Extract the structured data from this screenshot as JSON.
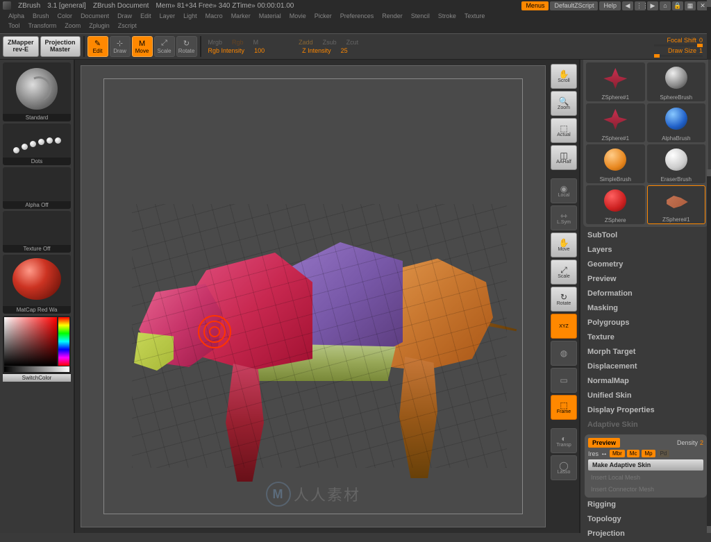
{
  "title": {
    "app": "ZBrush",
    "ver": "3.1 [general]",
    "doc": "ZBrush Document",
    "mem": "Mem» 81+34  Free» 340  ZTime» 00:00:01.00"
  },
  "titlebtns": {
    "menus": "Menus",
    "script": "DefaultZScript",
    "help": "Help"
  },
  "menu1": [
    "Alpha",
    "Brush",
    "Color",
    "Document",
    "Draw",
    "Edit",
    "Layer",
    "Light",
    "Macro",
    "Marker",
    "Material",
    "Movie",
    "Picker",
    "Preferences",
    "Render",
    "Stencil",
    "Stroke",
    "Texture"
  ],
  "menu2": [
    "Tool",
    "Transform",
    "Zoom",
    "Zplugin",
    "Zscript"
  ],
  "toolbar": {
    "zmapper": "ZMapper\nrev-E",
    "projmaster": "Projection\nMaster",
    "edit": "Edit",
    "draw": "Draw",
    "move": "Move",
    "scale": "Scale",
    "rotate": "Rotate",
    "mrgb": "Mrgb",
    "rgb": "Rgb",
    "m": "M",
    "zadd": "Zadd",
    "zsub": "Zsub",
    "zcut": "Zcut",
    "rgbint": "Rgb Intensity",
    "rgbintv": "100",
    "zint": "Z Intensity",
    "zintv": "25",
    "fshift": "Focal Shift",
    "fshiftv": "0",
    "dsize": "Draw Size",
    "dsizev": "1"
  },
  "shelf": {
    "standard": "Standard",
    "dots": "Dots",
    "alphaoff": "Alpha Off",
    "texoff": "Texture Off",
    "matcap": "MatCap Red Wa",
    "switchcolor": "SwitchColor"
  },
  "viewicons": {
    "scroll": "Scroll",
    "zoom": "Zoom",
    "actual": "Actual",
    "aahalf": "AAHalf",
    "local": "Local",
    "lsym": "L.Sym",
    "move": "Move",
    "scale": "Scale",
    "rotate": "Rotate",
    "xyz": "XYZ",
    "frame": "Frame",
    "transp": "Transp",
    "lasso": "Lasso"
  },
  "toolgrid": {
    "zsphere1": "ZSphere#1",
    "alphabrush": "AlphaBrush",
    "simplebrush": "SimpleBrush",
    "eraserbrush": "EraserBrush",
    "zsphere": "ZSphere",
    "zsphere1b": "ZSphere#1",
    "spherebrush": "SphereBrush"
  },
  "palette": [
    "SubTool",
    "Layers",
    "Geometry",
    "Preview",
    "Deformation",
    "Masking",
    "Polygroups",
    "Texture",
    "Morph Target",
    "Displacement",
    "NormalMap",
    "Unified Skin",
    "Display Properties",
    "Adaptive Skin"
  ],
  "palette2": [
    "Rigging",
    "Topology",
    "Projection"
  ],
  "adaptive": {
    "preview": "Preview",
    "density": "Density",
    "densityv": "2",
    "ires": "Ires",
    "mbr": "Mbr",
    "mc": "Mc",
    "mp": "Mp",
    "make": "Make Adaptive Skin",
    "insertlocal": "Insert Local Mesh",
    "insertconn": "Insert Connector Mesh"
  },
  "watermark": "人人素材"
}
